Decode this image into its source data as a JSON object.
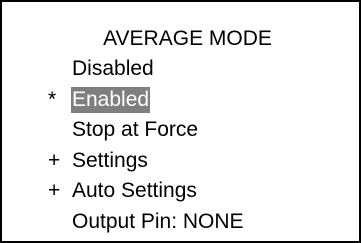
{
  "screen": {
    "title": "AVERAGE MODE",
    "highlight_color": "#7f7f7f",
    "items": [
      {
        "marker": "",
        "label": "Disabled",
        "selected": false
      },
      {
        "marker": "*",
        "label": "Enabled",
        "selected": true
      },
      {
        "marker": "",
        "label": "Stop at Force",
        "selected": false
      },
      {
        "marker": "+",
        "label": "Settings",
        "selected": false
      },
      {
        "marker": "+",
        "label": "Auto Settings",
        "selected": false
      },
      {
        "marker": "",
        "label": "Output Pin: NONE",
        "selected": false
      }
    ]
  }
}
